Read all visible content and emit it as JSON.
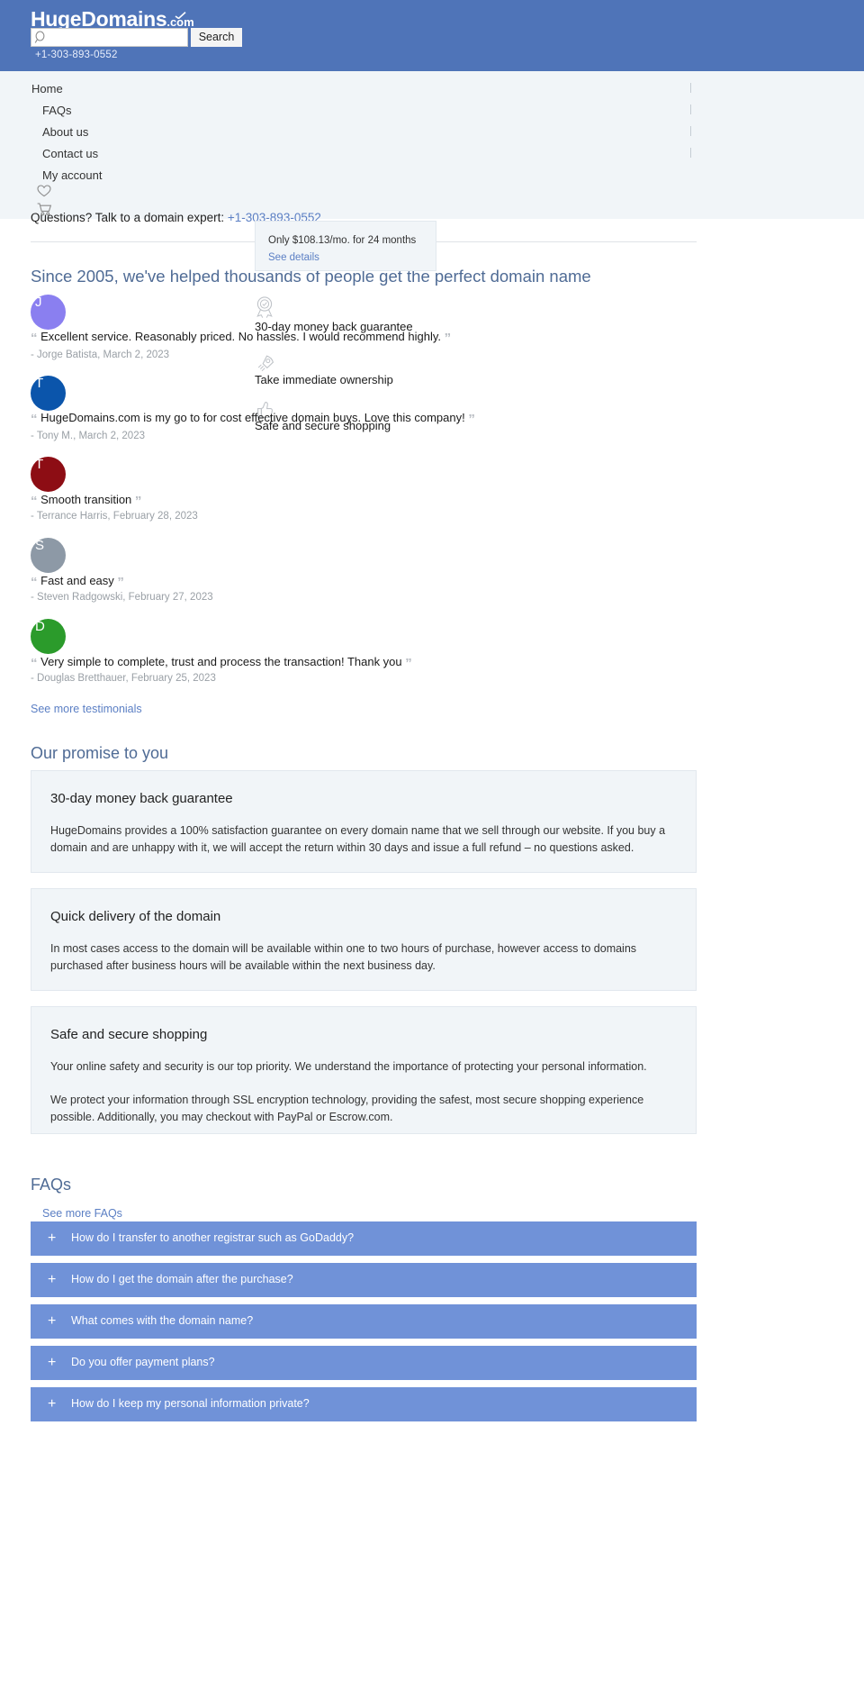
{
  "header": {
    "brand_main": "HugeDomains",
    "brand_suffix": ".com",
    "search_placeholder": "",
    "search_value": "",
    "search_button": "Search",
    "phone": "+1-303-893-0552",
    "bg_color": "#4f74b8"
  },
  "nav": {
    "items": [
      {
        "label": "Home"
      },
      {
        "label": "FAQs"
      },
      {
        "label": "About us"
      },
      {
        "label": "Contact us"
      },
      {
        "label": "My account"
      }
    ],
    "icons": [
      {
        "name": "heart-icon",
        "glyph": "♡"
      },
      {
        "name": "cart-icon",
        "glyph": "🛒"
      }
    ]
  },
  "questions_bar": {
    "text": "Questions? Talk to a domain expert:",
    "phone": "+1-303-893-0552"
  },
  "price_popup": {
    "text": "Only $108.13/mo. for 24 months ",
    "link": "See details"
  },
  "testimonials_section": {
    "title": "Since 2005, we've helped thousands of people get the perfect domain name",
    "see_more": "See more testimonials",
    "items": [
      {
        "initial": "J",
        "color": "#8a7ff0",
        "quote": "Excellent service. Reasonably priced. No hassles. I would recommend highly.",
        "author": "- Jorge Batista, March 2, 2023"
      },
      {
        "initial": "T",
        "color": "#0b55ab",
        "quote": "HugeDomains.com is my go to for cost effective domain buys. Love this company!",
        "author": "- Tony M., March 2, 2023"
      },
      {
        "initial": "T",
        "color": "#8d0d14",
        "quote": "Smooth transition",
        "author": "- Terrance Harris, February 28, 2023"
      },
      {
        "initial": "S",
        "color": "#8d99a6",
        "quote": "Fast and easy",
        "author": "- Steven Radgowski, February 27, 2023"
      },
      {
        "initial": "D",
        "color": "#2b9b2b",
        "quote": "Very simple to complete, trust and process the transaction! Thank you",
        "author": "- Douglas Bretthauer, February 25, 2023"
      }
    ]
  },
  "trust_badges": [
    {
      "icon": "badge-ribbon-icon",
      "glyph": "★",
      "label": "30-day money back guarantee"
    },
    {
      "icon": "rocket-icon",
      "glyph": "🚀",
      "label": "Take immediate ownership"
    },
    {
      "icon": "thumbs-up-icon",
      "glyph": "👍",
      "label": "Safe and secure shopping"
    }
  ],
  "promise_section": {
    "title": "Our promise to you",
    "cards": [
      {
        "heading": "30-day money back guarantee",
        "body": "HugeDomains provides a 100% satisfaction guarantee on every domain name that we sell through our website. If you buy a domain and are unhappy with it, we will accept the return within 30 days and issue a full refund – no questions asked.",
        "body2": ""
      },
      {
        "heading": "Quick delivery of the domain",
        "body": "In most cases access to the domain will be available within one to two hours of purchase, however access to domains purchased after business hours will be available within the next business day.",
        "body2": ""
      },
      {
        "heading": "Safe and secure shopping",
        "body": "Your online safety and security is our top priority. We understand the importance of protecting your personal information.",
        "body2": "We protect your information through SSL encryption technology, providing the safest, most secure shopping experience possible. Additionally, you may checkout with PayPal or Escrow.com."
      }
    ]
  },
  "faq_section": {
    "title": "FAQs",
    "see_more": "See more FAQs",
    "expand_glyph": "+",
    "bar_color": "#7092d8",
    "items": [
      {
        "question": "How do I transfer to another registrar such as GoDaddy?"
      },
      {
        "question": "How do I get the domain after the purchase?"
      },
      {
        "question": "What comes with the domain name?"
      },
      {
        "question": "Do you offer payment plans?"
      },
      {
        "question": "How do I keep my personal information private?"
      }
    ]
  }
}
